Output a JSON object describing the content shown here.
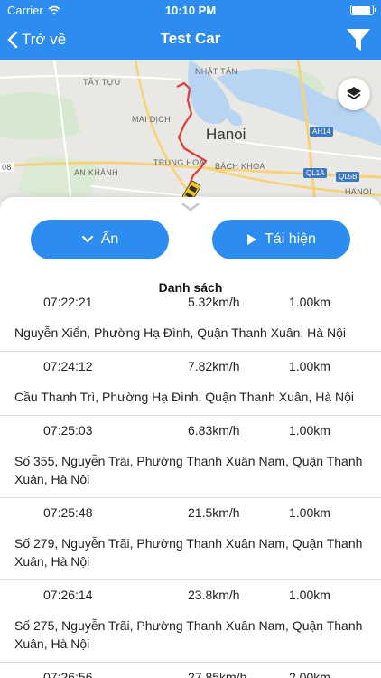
{
  "status_bar": {
    "carrier": "Carrier",
    "time": "10:10 PM"
  },
  "nav": {
    "back_label": "Trở về",
    "title": "Test Car",
    "filter_icon": "filter-icon"
  },
  "map": {
    "labels": {
      "nhat_tan": "NHẬT TÂN",
      "tay_tuu": "TÂY TỰU",
      "mai_dich": "MAI DỊCH",
      "hanoi": "Hanoi",
      "trung_hoa": "TRUNG HOÀ",
      "bach_khoa": "BÁCH KHOA",
      "an_khanh": "AN KHÁNH",
      "hanoi_small": "HANOI",
      "num_08": "08",
      "ah14": "AH14",
      "ql1a": "QL1A",
      "ql5b": "QL5B"
    },
    "layers_icon": "layers-icon",
    "colors": {
      "route": "#e23b3b",
      "vehicle": "#f5c518"
    }
  },
  "sheet": {
    "hide_label": "Ẩn",
    "replay_label": "Tái hiện",
    "list_title": "Danh sách"
  },
  "accent_color": "#2d8cf0",
  "records": [
    {
      "time": "07:22:21",
      "speed": "5.32km/h",
      "distance": "1.00km",
      "address": "Nguyễn Xiển, Phường Hạ Đình, Quận Thanh Xuân, Hà Nội"
    },
    {
      "time": "07:24:12",
      "speed": "7.82km/h",
      "distance": "1.00km",
      "address": "Cầu Thanh Trì, Phường Hạ Đình, Quận Thanh Xuân, Hà Nội"
    },
    {
      "time": "07:25:03",
      "speed": "6.83km/h",
      "distance": "1.00km",
      "address": "Số 355, Nguyễn Trãi, Phường Thanh Xuân Nam, Quận Thanh Xuân, Hà Nội"
    },
    {
      "time": "07:25:48",
      "speed": "21.5km/h",
      "distance": "1.00km",
      "address": "Số 279, Nguyễn Trãi, Phường Thanh Xuân Nam, Quận Thanh Xuân, Hà Nội"
    },
    {
      "time": "07:26:14",
      "speed": "23.8km/h",
      "distance": "1.00km",
      "address": "Số 275, Nguyễn Trãi, Phường Thanh Xuân Nam, Quận Thanh Xuân, Hà Nội"
    },
    {
      "time": "07:26:56",
      "speed": "27.85km/h",
      "distance": "2.00km",
      "address": ""
    }
  ]
}
